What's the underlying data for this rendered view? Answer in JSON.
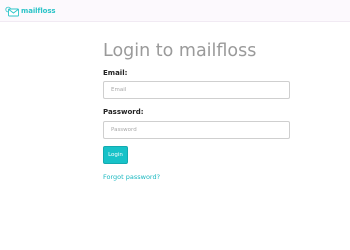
{
  "header": {
    "brand_name": "mailfloss",
    "logo_icon": "envelope-logo-icon"
  },
  "login": {
    "title": "Login to mailfloss",
    "email_label": "Email:",
    "email_placeholder": "Email",
    "email_value": "",
    "password_label": "Password:",
    "password_placeholder": "Password",
    "password_value": "",
    "submit_label": "Login",
    "forgot_link": "Forgot password?"
  },
  "colors": {
    "accent": "#17c2c8",
    "header_bg": "#fcf9fd",
    "title_text": "#9a9a9a"
  }
}
